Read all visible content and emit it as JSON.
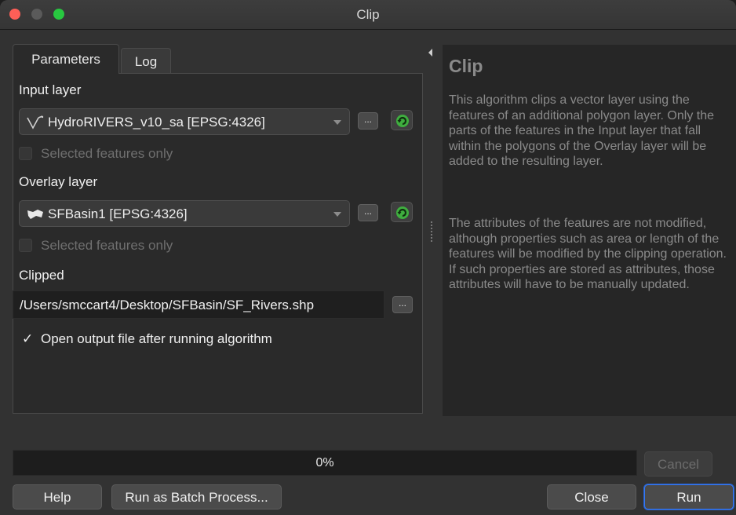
{
  "window": {
    "title": "Clip"
  },
  "tabs": [
    {
      "label": "Parameters",
      "active": true
    },
    {
      "label": "Log",
      "active": false
    }
  ],
  "parameters": {
    "input_layer": {
      "label": "Input layer",
      "value": "HydroRIVERS_v10_sa [EPSG:4326]",
      "icon": "line-layer-icon",
      "selected_only_label": "Selected features only",
      "browse_label": "..."
    },
    "overlay_layer": {
      "label": "Overlay layer",
      "value": "SFBasin1 [EPSG:4326]",
      "icon": "polygon-layer-icon",
      "selected_only_label": "Selected features only",
      "browse_label": "..."
    },
    "clipped": {
      "label": "Clipped",
      "value": "/Users/smccart4/Desktop/SFBasin/SF_Rivers.shp",
      "browse_label": "..."
    },
    "open_output": {
      "checkmark": "✓",
      "label": "Open output file after running algorithm",
      "checked": true
    }
  },
  "help": {
    "title": "Clip",
    "paragraph_1": "This algorithm clips a vector layer using the features of an additional polygon layer. Only the parts of the features in the Input layer that fall within the polygons of the Overlay layer will be added to the resulting layer.",
    "paragraph_2": "The attributes of the features are not modified, although properties such as area or length of the features will be modified by the clipping operation. If such properties are stored as attributes, those attributes will have to be manually updated."
  },
  "progress": {
    "text": "0%",
    "fraction": 0
  },
  "buttons": {
    "cancel": "Cancel",
    "help": "Help",
    "batch": "Run as Batch Process...",
    "close": "Close",
    "run": "Run"
  },
  "colors": {
    "accent": "#3478f6",
    "refresh_green": "#3fae3f"
  }
}
